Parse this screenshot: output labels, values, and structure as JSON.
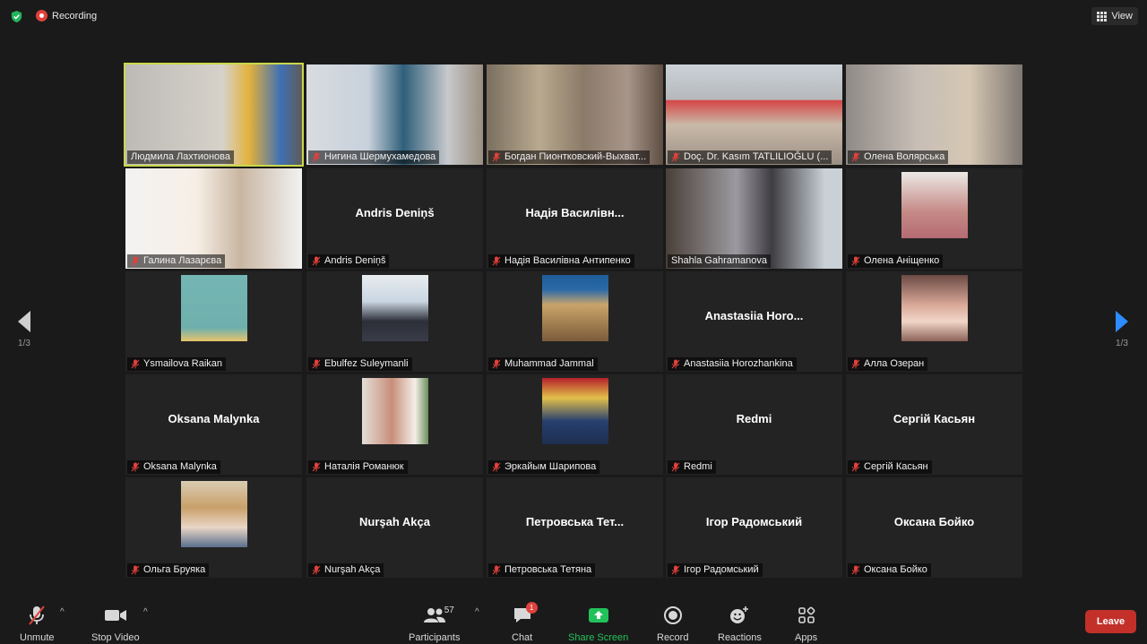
{
  "topbar": {
    "recording_label": "Recording",
    "view_label": "View"
  },
  "navigation": {
    "page_left": "1/3",
    "page_right": "1/3"
  },
  "tiles": [
    {
      "name": "Людмила Лахтионова",
      "center_name": "",
      "muted": false,
      "kind": "video",
      "active": true
    },
    {
      "name": "Нигина Шермухамедова",
      "center_name": "",
      "muted": true,
      "kind": "video"
    },
    {
      "name": "Богдан Пионтковский-Выхват...",
      "center_name": "",
      "muted": true,
      "kind": "video"
    },
    {
      "name": "Doç. Dr. Kasım TATLILIOĞLU (...",
      "center_name": "",
      "muted": true,
      "kind": "video"
    },
    {
      "name": "Олена Волярська",
      "center_name": "",
      "muted": true,
      "kind": "video"
    },
    {
      "name": "Галина Лазарєва",
      "center_name": "",
      "muted": true,
      "kind": "video"
    },
    {
      "name": "Andris Deniņš",
      "center_name": "Andris Deniņš",
      "muted": true,
      "kind": "name"
    },
    {
      "name": "Надія Василівна Антипенко",
      "center_name": "Надія Василівн...",
      "muted": true,
      "kind": "name"
    },
    {
      "name": "Shahla Gahramanova",
      "center_name": "",
      "muted": false,
      "kind": "video"
    },
    {
      "name": "Олена Аніщенко",
      "center_name": "",
      "muted": true,
      "kind": "photo"
    },
    {
      "name": "Ysmailova Raikan",
      "center_name": "",
      "muted": true,
      "kind": "photo"
    },
    {
      "name": "Ebulfez Suleymanli",
      "center_name": "",
      "muted": true,
      "kind": "photo"
    },
    {
      "name": "Muhammad Jammal",
      "center_name": "",
      "muted": true,
      "kind": "photo"
    },
    {
      "name": "Anastasiia Horozhankina",
      "center_name": "Anastasiia Horo...",
      "muted": true,
      "kind": "name"
    },
    {
      "name": "Алла Озеран",
      "center_name": "",
      "muted": true,
      "kind": "photo"
    },
    {
      "name": "Oksana Malynka",
      "center_name": "Oksana Malynka",
      "muted": true,
      "kind": "name"
    },
    {
      "name": "Наталія Романюк",
      "center_name": "",
      "muted": true,
      "kind": "photo"
    },
    {
      "name": "Эркайым Шарипова",
      "center_name": "",
      "muted": true,
      "kind": "photo"
    },
    {
      "name": "Redmi",
      "center_name": "Redmi",
      "muted": true,
      "kind": "name"
    },
    {
      "name": "Сергій Касьян",
      "center_name": "Сергій Касьян",
      "muted": true,
      "kind": "name"
    },
    {
      "name": "Ольга Бруяка",
      "center_name": "",
      "muted": true,
      "kind": "photo"
    },
    {
      "name": "Nurşah Akça",
      "center_name": "Nurşah Akça",
      "muted": true,
      "kind": "name"
    },
    {
      "name": "Петровська Тетяна",
      "center_name": "Петровська Тет...",
      "muted": true,
      "kind": "name"
    },
    {
      "name": "Ігор Радомський",
      "center_name": "Ігор Радомський",
      "muted": true,
      "kind": "name"
    },
    {
      "name": "Оксана Бойко",
      "center_name": "Оксана Бойко",
      "muted": true,
      "kind": "name"
    }
  ],
  "toolbar": {
    "unmute": "Unmute",
    "stop_video": "Stop Video",
    "participants": "Participants",
    "participants_count": "57",
    "chat": "Chat",
    "chat_badge": "1",
    "share_screen": "Share Screen",
    "record": "Record",
    "reactions": "Reactions",
    "apps": "Apps",
    "leave": "Leave"
  },
  "colors": {
    "share_green": "#22c25a",
    "leave_red": "#c3302a",
    "active_speaker": "#c9d94a",
    "nav_arrow_right": "#2d8cff"
  }
}
